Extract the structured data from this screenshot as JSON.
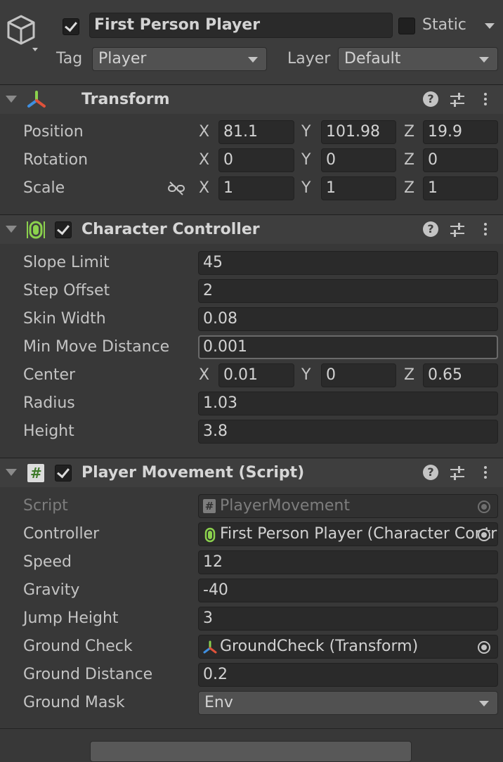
{
  "object": {
    "name": "First Person Player",
    "active": true,
    "static_label": "Static",
    "static": false,
    "tag_label": "Tag",
    "tag_value": "Player",
    "layer_label": "Layer",
    "layer_value": "Default"
  },
  "transform": {
    "title": "Transform",
    "rows": [
      {
        "label": "Position",
        "x": "81.1",
        "y": "101.98",
        "z": "19.9"
      },
      {
        "label": "Rotation",
        "x": "0",
        "y": "0",
        "z": "0"
      },
      {
        "label": "Scale",
        "x": "1",
        "y": "1",
        "z": "1"
      }
    ],
    "axis": {
      "x": "X",
      "y": "Y",
      "z": "Z"
    }
  },
  "character_controller": {
    "title": "Character Controller",
    "enabled": true,
    "slope_limit_label": "Slope Limit",
    "slope_limit": "45",
    "step_offset_label": "Step Offset",
    "step_offset": "2",
    "skin_width_label": "Skin Width",
    "skin_width": "0.08",
    "min_move_label": "Min Move Distance",
    "min_move": "0.001",
    "center_label": "Center",
    "center_x": "0.01",
    "center_y": "0",
    "center_z": "0.65",
    "radius_label": "Radius",
    "radius": "1.03",
    "height_label": "Height",
    "height": "3.8"
  },
  "player_movement": {
    "title": "Player Movement (Script)",
    "enabled": true,
    "script_label": "Script",
    "script_value": "PlayerMovement",
    "controller_label": "Controller",
    "controller_value": "First Person Player  (Character Controller)",
    "speed_label": "Speed",
    "speed": "12",
    "gravity_label": "Gravity",
    "gravity": "-40",
    "jump_label": "Jump Height",
    "jump": "3",
    "ground_check_label": "Ground Check",
    "ground_check": "GroundCheck (Transform)",
    "ground_distance_label": "Ground Distance",
    "ground_distance": "0.2",
    "ground_mask_label": "Ground Mask",
    "ground_mask": "Env"
  },
  "icons": {
    "gameobject": "cube-icon",
    "transform": "transform-axes-icon",
    "character_controller": "character-controller-icon",
    "script": "csharp-script-icon",
    "help": "help-icon",
    "presets": "presets-sliders-icon",
    "menu": "kebab-menu-icon",
    "link": "unlinked-scale-icon"
  },
  "colors": {
    "background": "#383838",
    "header": "#3e3e3e",
    "field": "#2a2a2a",
    "accent_green": "#8bd14d",
    "axis_red": "#e0523a",
    "axis_green": "#8bd14d",
    "axis_blue": "#3f8fe0"
  }
}
